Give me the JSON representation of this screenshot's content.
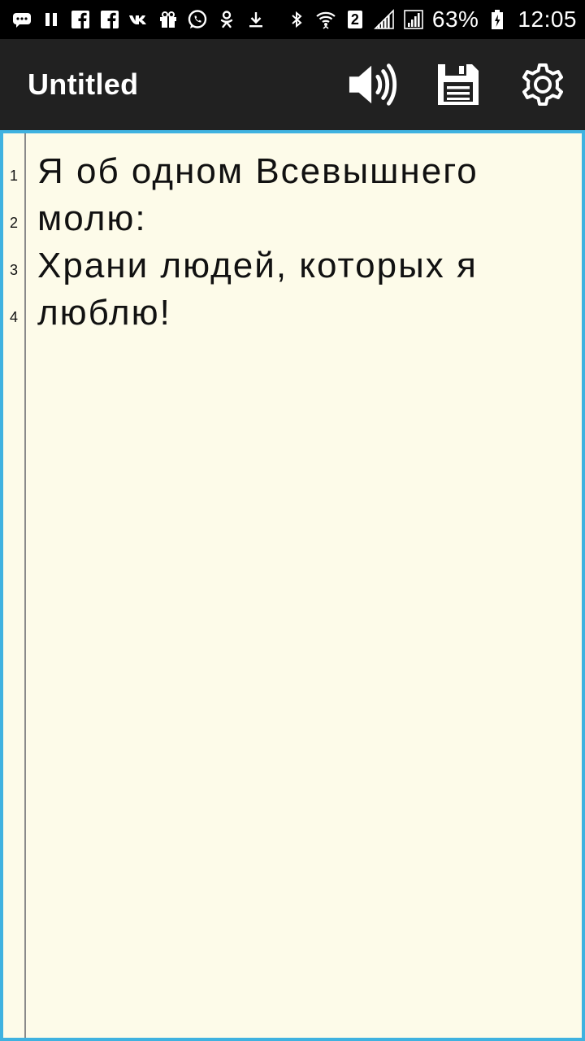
{
  "status_bar": {
    "left_icons": [
      "chat-bubble-icon",
      "pause-icon",
      "facebook-icon",
      "facebook-icon",
      "vk-icon",
      "gift-icon",
      "whatsapp-icon",
      "odnoklassniki-icon",
      "download-icon"
    ],
    "right_icons": [
      "bluetooth-icon",
      "wifi-icon",
      "sim-2-icon",
      "signal-icon",
      "signal-icon",
      "battery-icon"
    ],
    "sim_label": "2",
    "battery_percent": "63%",
    "time": "12:05"
  },
  "toolbar": {
    "title": "Untitled",
    "actions": [
      "speaker-icon",
      "save-icon",
      "gear-icon"
    ]
  },
  "editor": {
    "line_numbers": [
      "1",
      "2",
      "3",
      "4"
    ],
    "lines": [
      "Я об одном Всевышнего",
      "молю:",
      "Храни людей, которых я",
      "люблю!"
    ]
  },
  "colors": {
    "status_bar_bg": "#000000",
    "toolbar_bg": "#212121",
    "editor_bg": "#fdfbe9",
    "editor_border": "#3fb2e0",
    "text": "#111111"
  }
}
